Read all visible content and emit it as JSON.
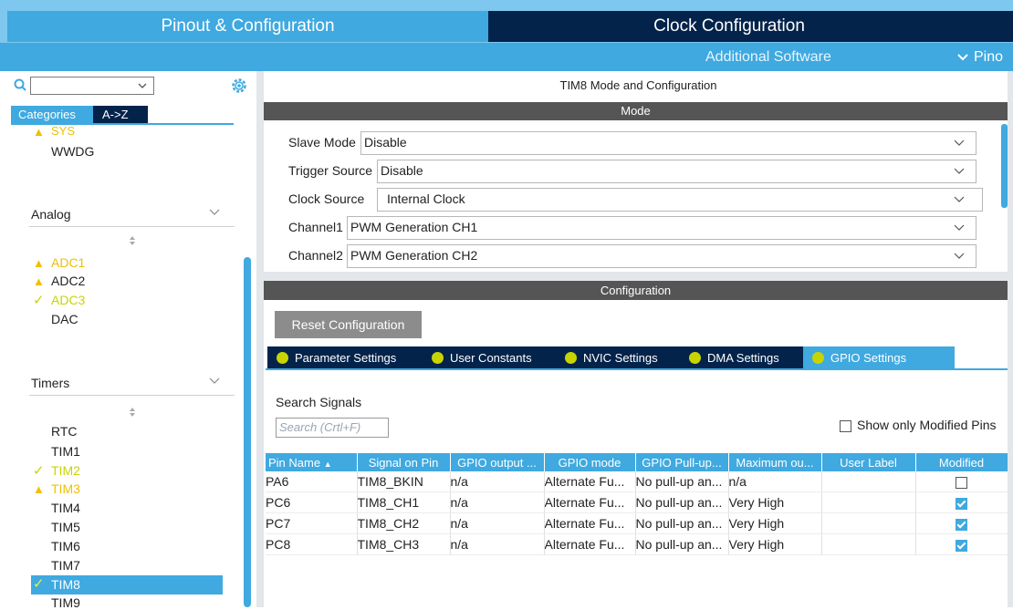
{
  "tabs": {
    "pinout": "Pinout & Configuration",
    "clock": "Clock Configuration"
  },
  "subbar": {
    "additional_software": "Additional Software",
    "pinout_menu": "Pino"
  },
  "sidebar": {
    "category_tab": "Categories",
    "az_tab": "A->Z",
    "system_items": [
      {
        "label": "SYS",
        "status": "warning"
      },
      {
        "label": "WWDG",
        "status": "none"
      }
    ],
    "analog": {
      "header": "Analog",
      "items": [
        {
          "label": "ADC1",
          "status": "warning"
        },
        {
          "label": "ADC2",
          "status": "warning"
        },
        {
          "label": "ADC3",
          "status": "ok"
        },
        {
          "label": "DAC",
          "status": "none"
        }
      ]
    },
    "timers": {
      "header": "Timers",
      "items": [
        {
          "label": "RTC",
          "status": "none"
        },
        {
          "label": "TIM1",
          "status": "none"
        },
        {
          "label": "TIM2",
          "status": "ok"
        },
        {
          "label": "TIM3",
          "status": "warning"
        },
        {
          "label": "TIM4",
          "status": "none"
        },
        {
          "label": "TIM5",
          "status": "none"
        },
        {
          "label": "TIM6",
          "status": "none"
        },
        {
          "label": "TIM7",
          "status": "none"
        },
        {
          "label": "TIM8",
          "status": "ok",
          "selected": true
        },
        {
          "label": "TIM9",
          "status": "none"
        }
      ]
    }
  },
  "main": {
    "title": "TIM8 Mode and Configuration",
    "mode_header": "Mode",
    "fields": [
      {
        "label": "Slave Mode",
        "value": "Disable"
      },
      {
        "label": "Trigger Source",
        "value": "Disable"
      },
      {
        "label": "Clock Source",
        "value": "Internal Clock"
      },
      {
        "label": "Channel1",
        "value": "PWM Generation CH1"
      },
      {
        "label": "Channel2",
        "value": "PWM Generation CH2"
      }
    ],
    "config_header": "Configuration",
    "reset_button": "Reset Configuration",
    "config_tabs": [
      {
        "label": "Parameter Settings",
        "active": false
      },
      {
        "label": "User Constants",
        "active": false
      },
      {
        "label": "NVIC Settings",
        "active": false
      },
      {
        "label": "DMA Settings",
        "active": false
      },
      {
        "label": "GPIO Settings",
        "active": true
      }
    ],
    "search_signals_label": "Search Signals",
    "search_placeholder": "Search (Crtl+F)",
    "show_modified_label": "Show only Modified Pins",
    "table": {
      "headers": [
        "Pin Name",
        "Signal on Pin",
        "GPIO output ...",
        "GPIO mode",
        "GPIO Pull-up...",
        "Maximum ou...",
        "User Label",
        "Modified"
      ],
      "rows": [
        {
          "pin": "PA6",
          "signal": "TIM8_BKIN",
          "output": "n/a",
          "mode": "Alternate Fu...",
          "pull": "No pull-up an...",
          "max": "n/a",
          "label": "",
          "modified": false
        },
        {
          "pin": "PC6",
          "signal": "TIM8_CH1",
          "output": "n/a",
          "mode": "Alternate Fu...",
          "pull": "No pull-up an...",
          "max": "Very High",
          "label": "",
          "modified": true
        },
        {
          "pin": "PC7",
          "signal": "TIM8_CH2",
          "output": "n/a",
          "mode": "Alternate Fu...",
          "pull": "No pull-up an...",
          "max": "Very High",
          "label": "",
          "modified": true
        },
        {
          "pin": "PC8",
          "signal": "TIM8_CH3",
          "output": "n/a",
          "mode": "Alternate Fu...",
          "pull": "No pull-up an...",
          "max": "Very High",
          "label": "",
          "modified": true
        }
      ]
    }
  },
  "colors": {
    "accent": "#3fa9e0",
    "dark_navy": "#03234b",
    "warning": "#f0c000",
    "ok": "#c8d400"
  }
}
